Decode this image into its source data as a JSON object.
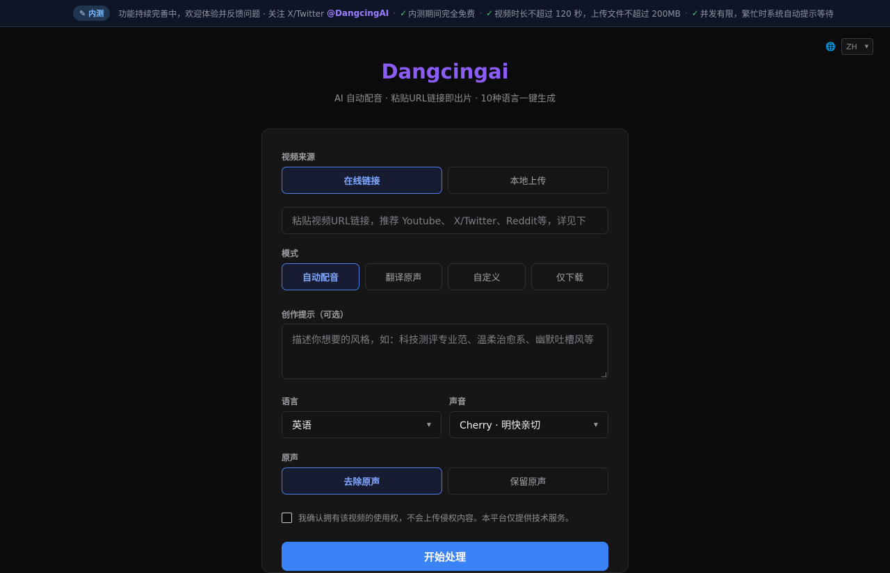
{
  "topbar": {
    "badge_icon": "pen-icon",
    "badge_label": "内测",
    "notice_text": "功能持续完善中，欢迎体验并反馈问题 · 关注 X/Twitter",
    "twitter_handle": "@DangcingAI",
    "items": [
      "内测期间完全免费",
      "视频时长不超过 120 秒，上传文件不超过 200MB",
      "并发有限，繁忙时系统自动提示等待"
    ],
    "check_color": "#3ecf6e"
  },
  "language_switch": {
    "icon": "globe-icon",
    "value": "ZH"
  },
  "header": {
    "brand": "Dangcingai",
    "brand_color": "#8b5cf6",
    "tagline": "AI 自动配音 · 粘贴URL链接即出片 · 10种语言一键生成"
  },
  "form": {
    "source": {
      "label": "视频来源",
      "options": [
        "在线链接",
        "本地上传"
      ],
      "selected": "在线链接"
    },
    "url_input": {
      "placeholder": "粘贴视频URL链接，推荐 Youtube、 X/Twitter、Reddit等，详见下",
      "value": ""
    },
    "mode": {
      "label": "模式",
      "options": [
        "自动配音",
        "翻译原声",
        "自定义",
        "仅下载"
      ],
      "selected": "自动配音"
    },
    "prompt": {
      "label": "创作提示（可选）",
      "placeholder": "描述你想要的风格，如：科技测评专业范、温柔治愈系、幽默吐槽风等",
      "value": ""
    },
    "language": {
      "label": "语言",
      "selected": "英语"
    },
    "voice": {
      "label": "声音",
      "selected": "Cherry · 明快亲切"
    },
    "original_audio": {
      "label": "原声",
      "options": [
        "去除原声",
        "保留原声"
      ],
      "selected": "去除原声"
    },
    "consent": {
      "checked": false,
      "text": "我确认拥有该视频的使用权，不会上传侵权内容。本平台仅提供技术服务。"
    },
    "submit_label": "开始处理",
    "accent_color": "#3b82f6"
  }
}
